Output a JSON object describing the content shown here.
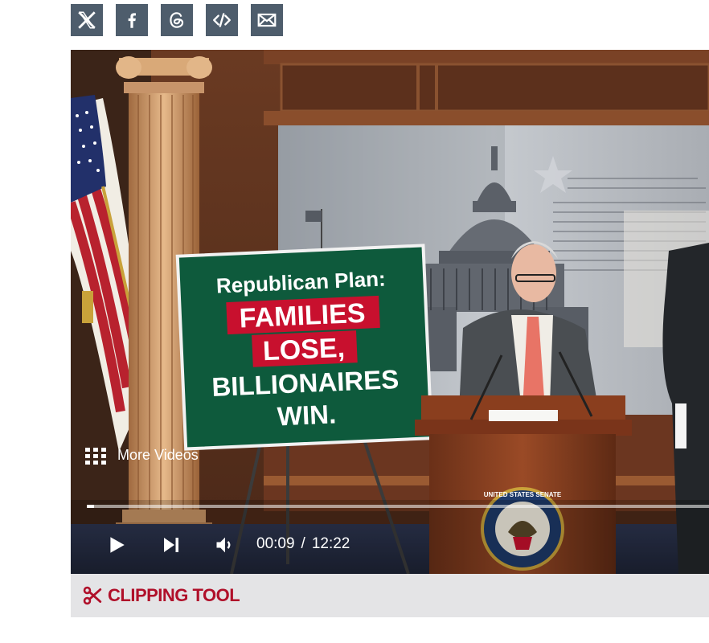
{
  "share": {
    "buttons": [
      {
        "icon": "x-twitter-icon",
        "label": "X"
      },
      {
        "icon": "facebook-icon",
        "label": "f"
      },
      {
        "icon": "threads-icon",
        "label": "@"
      },
      {
        "icon": "embed-code-icon",
        "label": "</>"
      },
      {
        "icon": "email-icon",
        "label": "Email"
      }
    ],
    "button_color": "#4e5d6c"
  },
  "video": {
    "sign": {
      "line1": "Republican Plan:",
      "line2": "FAMILIES",
      "line3": "LOSE,",
      "line4": "BILLIONAIRES",
      "line5": "WIN."
    },
    "seal_text": "UNITED STATES SENATE",
    "more_videos_label": "More Videos",
    "current_time": "00:09",
    "time_separator": "/",
    "duration": "12:22",
    "progress_fraction": 0.012
  },
  "clipping_tool": {
    "label": "CLIPPING TOOL",
    "color": "#b0102a"
  }
}
